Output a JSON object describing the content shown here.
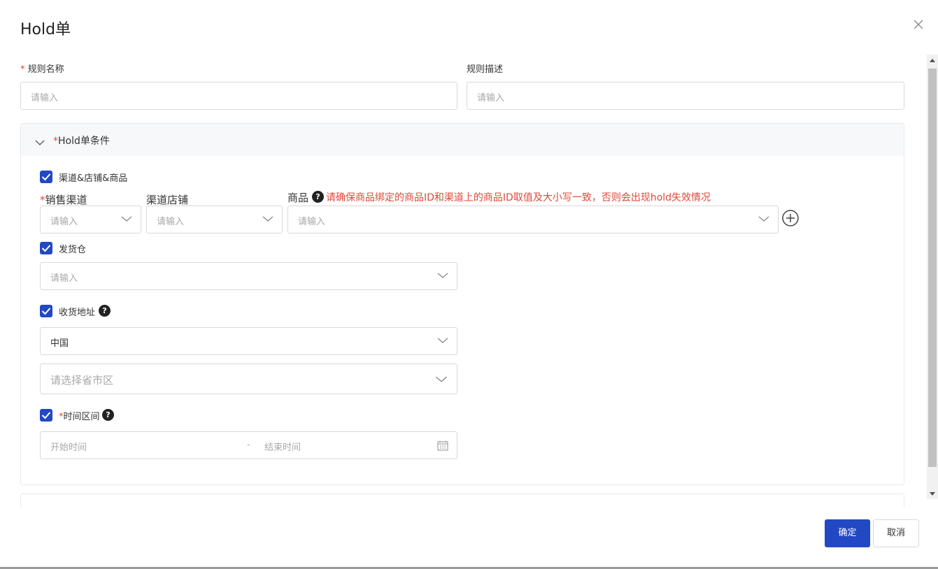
{
  "dialog": {
    "title": "Hold单",
    "close_icon": "close-icon"
  },
  "rule_name": {
    "label": "规则名称",
    "required_mark": "*",
    "placeholder": "请输入"
  },
  "rule_desc": {
    "label": "规则描述",
    "placeholder": "请输入"
  },
  "conditions": {
    "required_mark": "*",
    "title": "Hold单条件",
    "expand_icon": "chevron-down-icon",
    "channel_shop_product": {
      "checkbox_label": "渠道&店铺&商品",
      "checked": true,
      "channel_label": "销售渠道",
      "channel_required": "*",
      "channel_placeholder": "请输入",
      "shop_label": "渠道店铺",
      "shop_placeholder": "请输入",
      "product_label": "商品",
      "product_warning": "请确保商品绑定的商品ID和渠道上的商品ID取值及大小写一致，否则会出现hold失效情况",
      "product_placeholder": "请输入",
      "add_icon": "plus-circle-icon"
    },
    "warehouse": {
      "checkbox_label": "发货仓",
      "checked": true,
      "placeholder": "请输入"
    },
    "address": {
      "checkbox_label": "收货地址",
      "checked": true,
      "country_value": "中国",
      "region_placeholder": "请选择省市区"
    },
    "time_range": {
      "required_mark": "*",
      "checkbox_label": "时间区间",
      "checked": true,
      "start_placeholder": "开始时间",
      "separator": "-",
      "end_placeholder": "结束时间",
      "calendar_icon": "calendar-icon"
    }
  },
  "footer": {
    "confirm_label": "确定",
    "cancel_label": "取消"
  },
  "colors": {
    "primary": "#2248c4",
    "danger": "#e0483a"
  }
}
